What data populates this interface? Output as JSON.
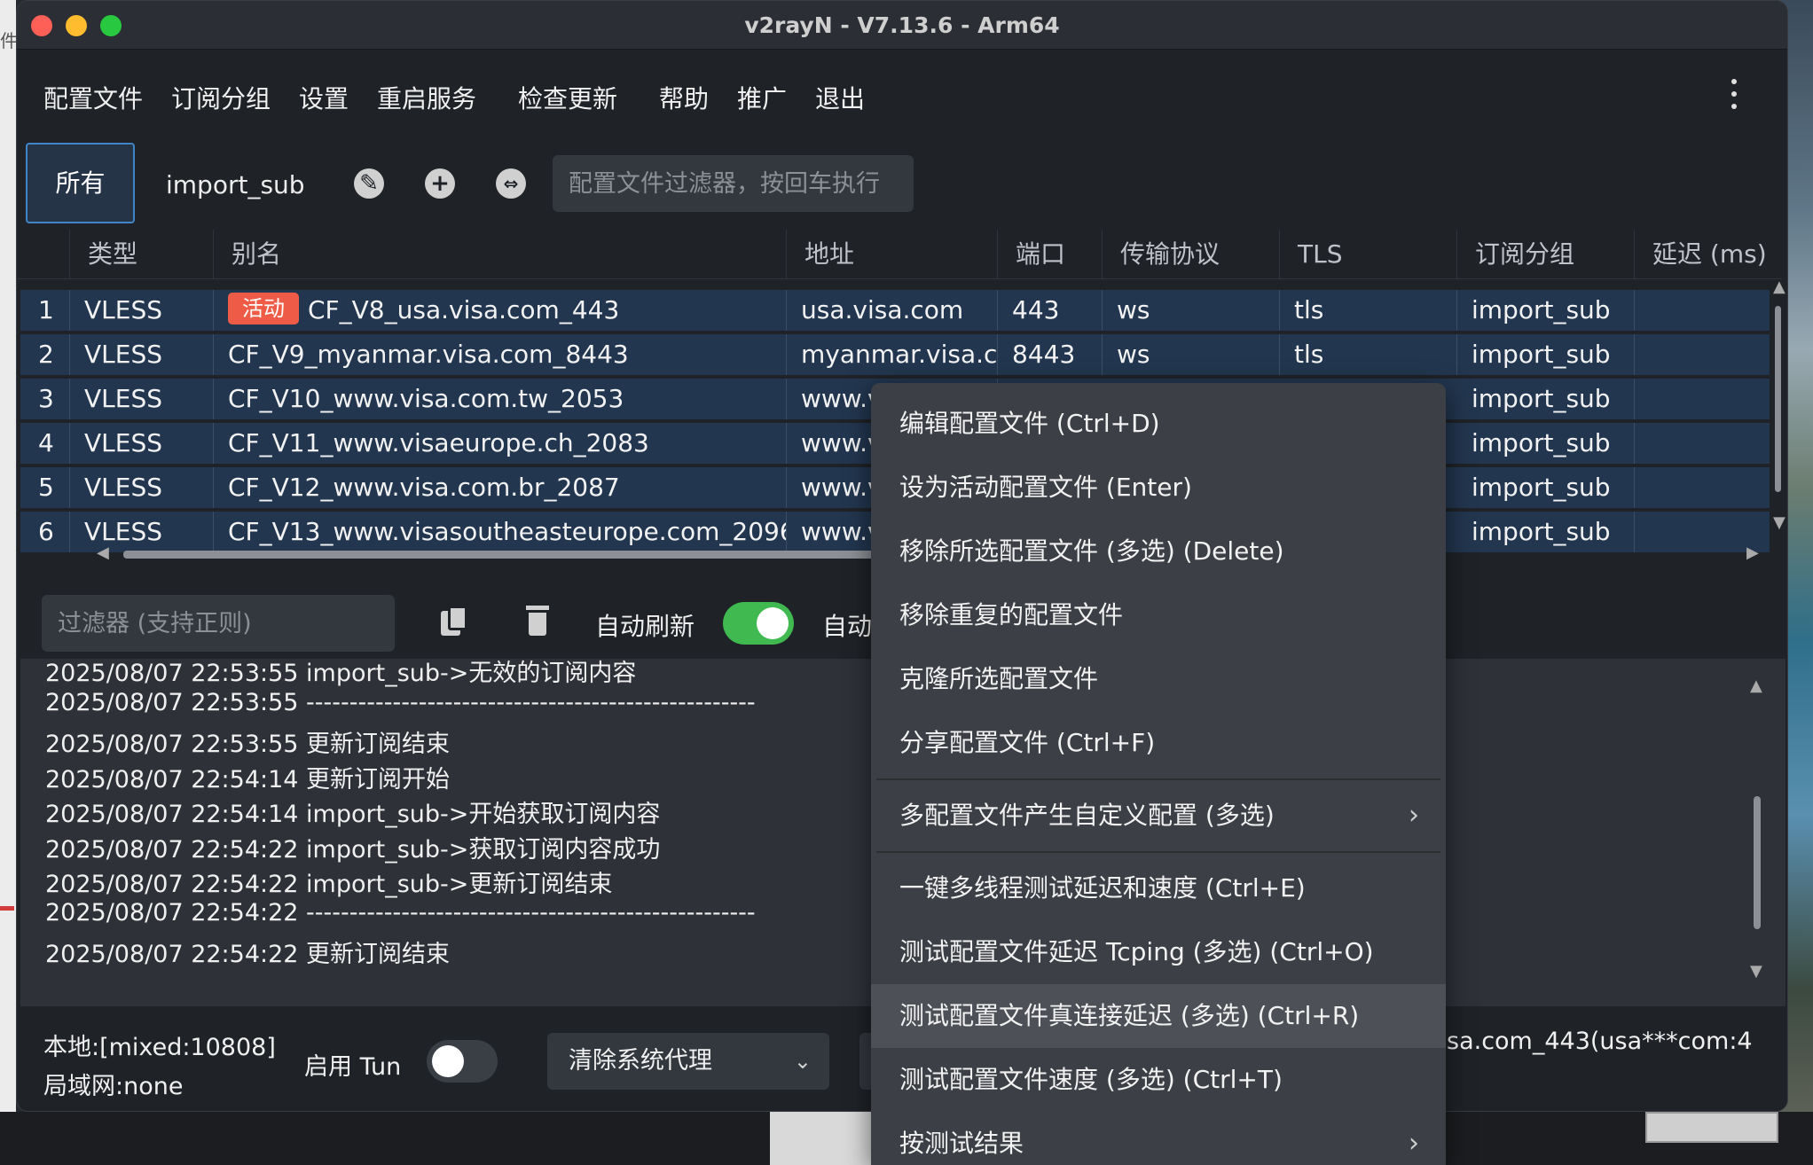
{
  "window": {
    "title": "v2rayN - V7.13.6 - Arm64"
  },
  "desktop": {
    "left_label": "件"
  },
  "menu": [
    "配置文件",
    "订阅分组",
    "设置",
    "重启服务",
    "检查更新",
    "帮助",
    "推广",
    "退出"
  ],
  "toolbar": {
    "tab_all": "所有",
    "tab_sub": "import_sub",
    "filter_placeholder": "配置文件过滤器，按回车执行"
  },
  "grid": {
    "headers": [
      "类型",
      "别名",
      "地址",
      "端口",
      "传输协议",
      "TLS",
      "订阅分组",
      "延迟 (ms)"
    ],
    "active_badge": "活动",
    "rows": [
      {
        "num": "1",
        "type": "VLESS",
        "alias": "CF_V8_usa.visa.com_443",
        "address": "usa.visa.com",
        "port": "443",
        "transport": "ws",
        "tls": "tls",
        "sub": "import_sub"
      },
      {
        "num": "2",
        "type": "VLESS",
        "alias": "CF_V9_myanmar.visa.com_8443",
        "address": "myanmar.visa.c",
        "port": "8443",
        "transport": "ws",
        "tls": "tls",
        "sub": "import_sub"
      },
      {
        "num": "3",
        "type": "VLESS",
        "alias": "CF_V10_www.visa.com.tw_2053",
        "address": "www.vi",
        "sub": "import_sub"
      },
      {
        "num": "4",
        "type": "VLESS",
        "alias": "CF_V11_www.visaeurope.ch_2083",
        "address": "www.vi",
        "sub": "import_sub"
      },
      {
        "num": "5",
        "type": "VLESS",
        "alias": "CF_V12_www.visa.com.br_2087",
        "address": "www.vi",
        "sub": "import_sub"
      },
      {
        "num": "6",
        "type": "VLESS",
        "alias": "CF_V13_www.visasoutheasteurope.com_2096",
        "address": "www.vi",
        "sub": "import_sub"
      }
    ]
  },
  "logbar": {
    "filter_placeholder": "过滤器 (支持正则)",
    "auto_refresh": "自动刷新",
    "auto_scroll_partial": "自动"
  },
  "logs": [
    "2025/08/07 22:53:55 import_sub->无效的订阅内容",
    "2025/08/07 22:53:55 ----------------------------------------------------",
    "2025/08/07 22:53:55 更新订阅结束",
    "2025/08/07 22:54:14 更新订阅开始",
    "2025/08/07 22:54:14 import_sub->开始获取订阅内容",
    "2025/08/07 22:54:22 import_sub->获取订阅内容成功",
    "2025/08/07 22:54:22 import_sub->更新订阅结束",
    "2025/08/07 22:54:22 ----------------------------------------------------",
    "2025/08/07 22:54:22 更新订阅结束"
  ],
  "status": {
    "local": "本地:[mixed:10808]",
    "lan": "局域网:none",
    "tun_label": "启用 Tun",
    "proxy_select": "清除系统代理",
    "current_server": "sa.com_443(usa***com:4"
  },
  "context_menu": {
    "items": [
      "编辑配置文件 (Ctrl+D)",
      "设为活动配置文件 (Enter)",
      "移除所选配置文件 (多选) (Delete)",
      "移除重复的配置文件",
      "克隆所选配置文件",
      "分享配置文件 (Ctrl+F)",
      "多配置文件产生自定义配置 (多选)",
      "一键多线程测试延迟和速度 (Ctrl+E)",
      "测试配置文件延迟 Tcping (多选) (Ctrl+O)",
      "测试配置文件真连接延迟 (多选) (Ctrl+R)",
      "测试配置文件速度 (多选) (Ctrl+T)",
      "按测试结果"
    ]
  }
}
